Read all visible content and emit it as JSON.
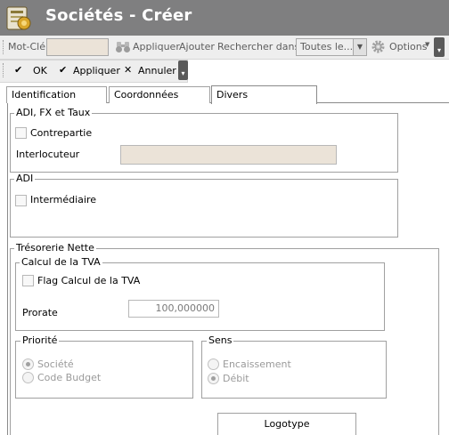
{
  "window": {
    "title": "Sociétés - Créer",
    "app_icon": "app-icon"
  },
  "toolbar1": {
    "keyword_label": "Mot-Clé",
    "keyword_value": "",
    "apply_label": "Appliquer",
    "add_label": "Ajouter",
    "search_in_label": "Rechercher dans",
    "search_in_value": "Toutes le...",
    "options_label": "Options",
    "binoculars_icon": "binoculars-icon",
    "gear_icon": "gear-icon"
  },
  "toolbar2": {
    "ok_label": "OK",
    "apply_label": "Appliquer",
    "cancel_label": "Annuler"
  },
  "tabs": [
    {
      "label": "Identification",
      "active": false
    },
    {
      "label": "Coordonnées",
      "active": false
    },
    {
      "label": "Divers",
      "active": true
    }
  ],
  "adi_fx": {
    "legend": "ADI, FX et Taux",
    "counterpart_label": "Contrepartie",
    "counterpart_checked": false,
    "contact_label": "Interlocuteur",
    "contact_value": ""
  },
  "adi": {
    "legend": "ADI",
    "intermediary_label": "Intermédiaire",
    "intermediary_checked": false
  },
  "treasury": {
    "legend": "Trésorerie Nette",
    "vat": {
      "legend": "Calcul de la TVA",
      "flag_label": "Flag Calcul de la TVA",
      "flag_checked": false,
      "prorate_label": "Prorate",
      "prorate_value": "100,000000"
    },
    "priority": {
      "legend": "Priorité",
      "options": [
        "Société",
        "Code Budget"
      ],
      "selected": "Société"
    },
    "direction": {
      "legend": "Sens",
      "options": [
        "Encaissement",
        "Débit"
      ],
      "selected": "Débit"
    }
  },
  "logo_button_label": "Logotype"
}
